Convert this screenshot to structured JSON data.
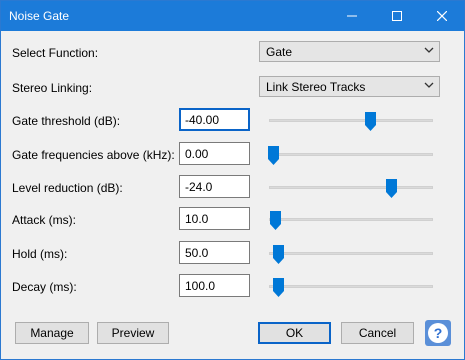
{
  "window": {
    "title": "Noise Gate"
  },
  "titlebar_icons": {
    "minimize": "minimize-icon",
    "maximize": "maximize-icon",
    "close": "close-icon"
  },
  "select_function": {
    "label": "Select Function:",
    "value": "Gate"
  },
  "stereo_linking": {
    "label": "Stereo Linking:",
    "value": "Link Stereo Tracks"
  },
  "params": [
    {
      "label": "Gate threshold (dB):",
      "value": "-40.00",
      "slider_fraction": 0.61
    },
    {
      "label": "Gate frequencies above (kHz):",
      "value": "0.00",
      "slider_fraction": 0.02
    },
    {
      "label": "Level reduction (dB):",
      "value": "-24.0",
      "slider_fraction": 0.74
    },
    {
      "label": "Attack (ms):",
      "value": "10.0",
      "slider_fraction": 0.03
    },
    {
      "label": "Hold (ms):",
      "value": "50.0",
      "slider_fraction": 0.05
    },
    {
      "label": "Decay (ms):",
      "value": "100.0",
      "slider_fraction": 0.05
    }
  ],
  "buttons": {
    "manage": "Manage",
    "preview": "Preview",
    "ok": "OK",
    "cancel": "Cancel",
    "help": "?"
  },
  "colors": {
    "accent": "#0078d7",
    "titlebar": "#1c7bd9"
  }
}
